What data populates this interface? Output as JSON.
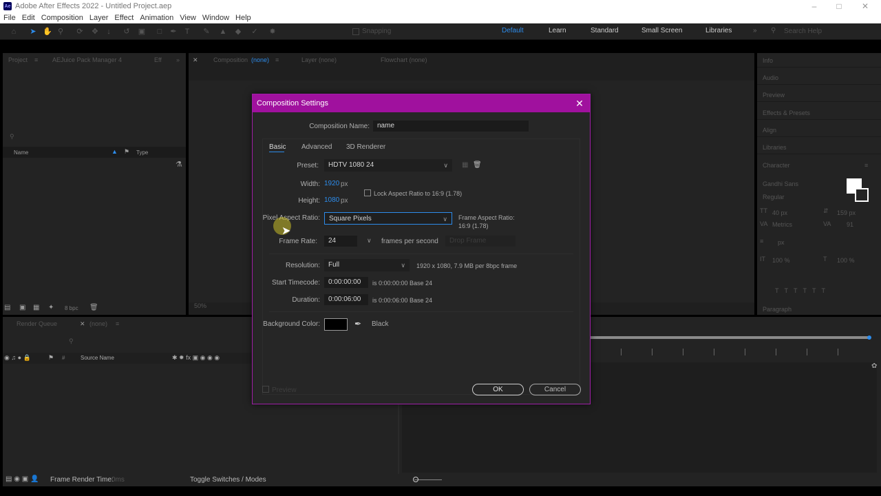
{
  "window": {
    "title": "Adobe After Effects 2022 - Untitled Project.aep",
    "app_badge": "Ae"
  },
  "menu": [
    "File",
    "Edit",
    "Composition",
    "Layer",
    "Effect",
    "Animation",
    "View",
    "Window",
    "Help"
  ],
  "toolbar": {
    "snapping_label": "Snapping",
    "search_placeholder": "Search Help"
  },
  "workspaces": [
    "Default",
    "Learn",
    "Standard",
    "Small Screen",
    "Libraries"
  ],
  "project_panel": {
    "tab_project": "Project",
    "tab_aejuice": "AEJuice Pack Manager 4",
    "tab_effects": "Eff",
    "col_name": "Name",
    "col_type": "Type",
    "bpc_label": "8 bpc"
  },
  "comp_viewer": {
    "tab_composition": "Composition",
    "comp_none": "(none)",
    "tab_layer": "Layer (none)",
    "tab_flowchart": "Flowchart (none)",
    "zoom": "50%"
  },
  "right_panels": [
    "Info",
    "Audio",
    "Preview",
    "Effects & Presets",
    "Align",
    "Libraries",
    "Character"
  ],
  "character_panel": {
    "font": "Gandhi Sans",
    "style": "Regular",
    "size": "40 px",
    "leading": "159 px",
    "kerning": "Metrics",
    "tracking": "91",
    "stroke_unit": "px",
    "vert_scale": "100 %",
    "horiz_scale": "100 %",
    "paragraph_tab": "Paragraph"
  },
  "timeline": {
    "tab_render_queue": "Render Queue",
    "tab_none": "(none)",
    "col_source_name": "Source Name",
    "frame_render_label": "Frame Render Time:",
    "frame_render_value": "0ms",
    "toggle_label": "Toggle Switches / Modes"
  },
  "dialog": {
    "title": "Composition Settings",
    "comp_name_label": "Composition Name:",
    "comp_name_value": "name",
    "tabs": [
      "Basic",
      "Advanced",
      "3D Renderer"
    ],
    "preset_label": "Preset:",
    "preset_value": "HDTV 1080 24",
    "width_label": "Width:",
    "width_value": "1920",
    "width_unit": "px",
    "height_label": "Height:",
    "height_value": "1080",
    "height_unit": "px",
    "lock_label": "Lock Aspect Ratio to 16:9 (1.78)",
    "par_label": "Pixel Aspect Ratio:",
    "par_value": "Square Pixels",
    "far_label": "Frame Aspect Ratio:",
    "far_value": "16:9 (1.78)",
    "frame_rate_label": "Frame Rate:",
    "frame_rate_value": "24",
    "frame_rate_unit": "frames per second",
    "drop_frame": "Drop Frame",
    "resolution_label": "Resolution:",
    "resolution_value": "Full",
    "resolution_info": "1920 x 1080, 7.9 MB per 8bpc frame",
    "start_tc_label": "Start Timecode:",
    "start_tc_value": "0:00:00:00",
    "start_tc_info": "is 0:00:00:00  Base 24",
    "duration_label": "Duration:",
    "duration_value": "0:00:06:00",
    "duration_info": "is 0:00:06:00  Base 24",
    "bg_label": "Background Color:",
    "bg_name": "Black",
    "bg_color": "#000000",
    "preview_label": "Preview",
    "ok": "OK",
    "cancel": "Cancel"
  },
  "colors": {
    "dialog_title_bar": "#a0119e",
    "accent_blue": "#2d8ceb"
  }
}
